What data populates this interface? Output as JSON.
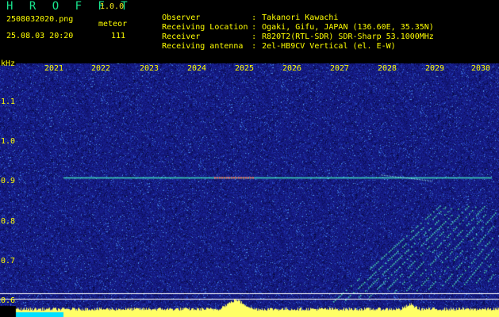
{
  "app": {
    "title": "H R O F F T",
    "version": "1.0.0",
    "filename": "2508032020.png",
    "mode": "meteor",
    "datetime": "25.08.03 20:20",
    "count": "111"
  },
  "info": [
    {
      "label": "Observer",
      "value": "Takanori Kawachi"
    },
    {
      "label": "Receiving Location",
      "value": "Ogaki, Gifu, JAPAN (136.60E, 35.35N)"
    },
    {
      "label": "Receiver",
      "value": "R820T2(RTL-SDR) SDR-Sharp 53.1000MHz"
    },
    {
      "label": "Receiving antenna",
      "value": "2el-HB9CV Vertical (el. E-W)"
    }
  ],
  "axis": {
    "unit": "kHz",
    "x_ticks": [
      "2021",
      "2022",
      "2023",
      "2024",
      "2025",
      "2026",
      "2027",
      "2028",
      "2029",
      "2030"
    ],
    "y_ticks": [
      "1.1",
      "1.0",
      "0.9",
      "0.8",
      "0.7",
      "0.6"
    ]
  },
  "colors": {
    "background": "#1a1f8a",
    "beacon": "#40e0c0",
    "meteor": "#4fe6b0",
    "header_yellow": "#ffff00",
    "title_green": "#19e38d",
    "noise_floor": "#ffff66"
  },
  "signals": {
    "beacon_freq_khz": 0.91,
    "reference_lines_khz": [
      0.62,
      0.605
    ]
  }
}
